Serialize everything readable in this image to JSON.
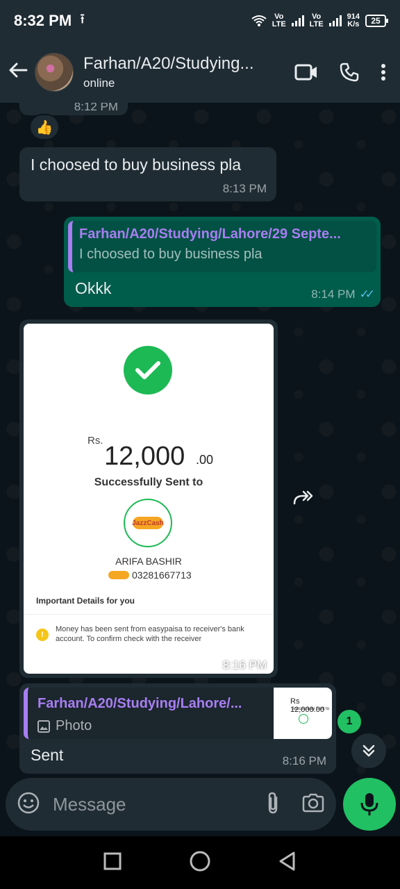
{
  "status_bar": {
    "time": "8:32 PM",
    "network_1": "Vo\nLTE",
    "network_2": "Vo\nLTE",
    "speed": "914\nK/s",
    "battery": "25"
  },
  "header": {
    "title": "Farhan/A20/Studying...",
    "subtitle": "online"
  },
  "messages": {
    "partial_time": "8:12 PM",
    "reaction": "👍",
    "m1_text": "I choosed to buy business pla",
    "m1_time": "8:13 PM",
    "m2_quote_name": "Farhan/A20/Studying/Lahore/29 Septe...",
    "m2_quote_text": "I choosed to buy business pla",
    "m2_text": "Okkk",
    "m2_time": "8:14 PM",
    "m3_time": "8:16 PM",
    "m4_quote_name": "Farhan/A20/Studying/Lahore/...",
    "m4_quote_type": "Photo",
    "m4_text": "Sent",
    "m4_time": "8:16 PM",
    "unread_count": "1"
  },
  "receipt": {
    "currency": "Rs.",
    "amount": "12,000",
    "amount_decimal": ".00",
    "sent_label": "Successfully Sent to",
    "logo_text": "JazzCash",
    "recipient_name": "ARIFA BASHIR",
    "recipient_phone": "03281667713",
    "details_heading": "Important Details for you",
    "notice": "Money has been sent from easypaisa to receiver's bank account. To confirm check with the receiver"
  },
  "thumbnail": {
    "amount": "Rs 12,000.00",
    "sent_label": "Successfully Sent to"
  },
  "input": {
    "placeholder": "Message"
  },
  "colors": {
    "accent_green": "#21c063",
    "quote_purple": "#a87ef2",
    "outgoing_bubble": "#005c4b",
    "incoming_bubble": "#1f2c34",
    "read_ticks": "#53bdeb"
  }
}
